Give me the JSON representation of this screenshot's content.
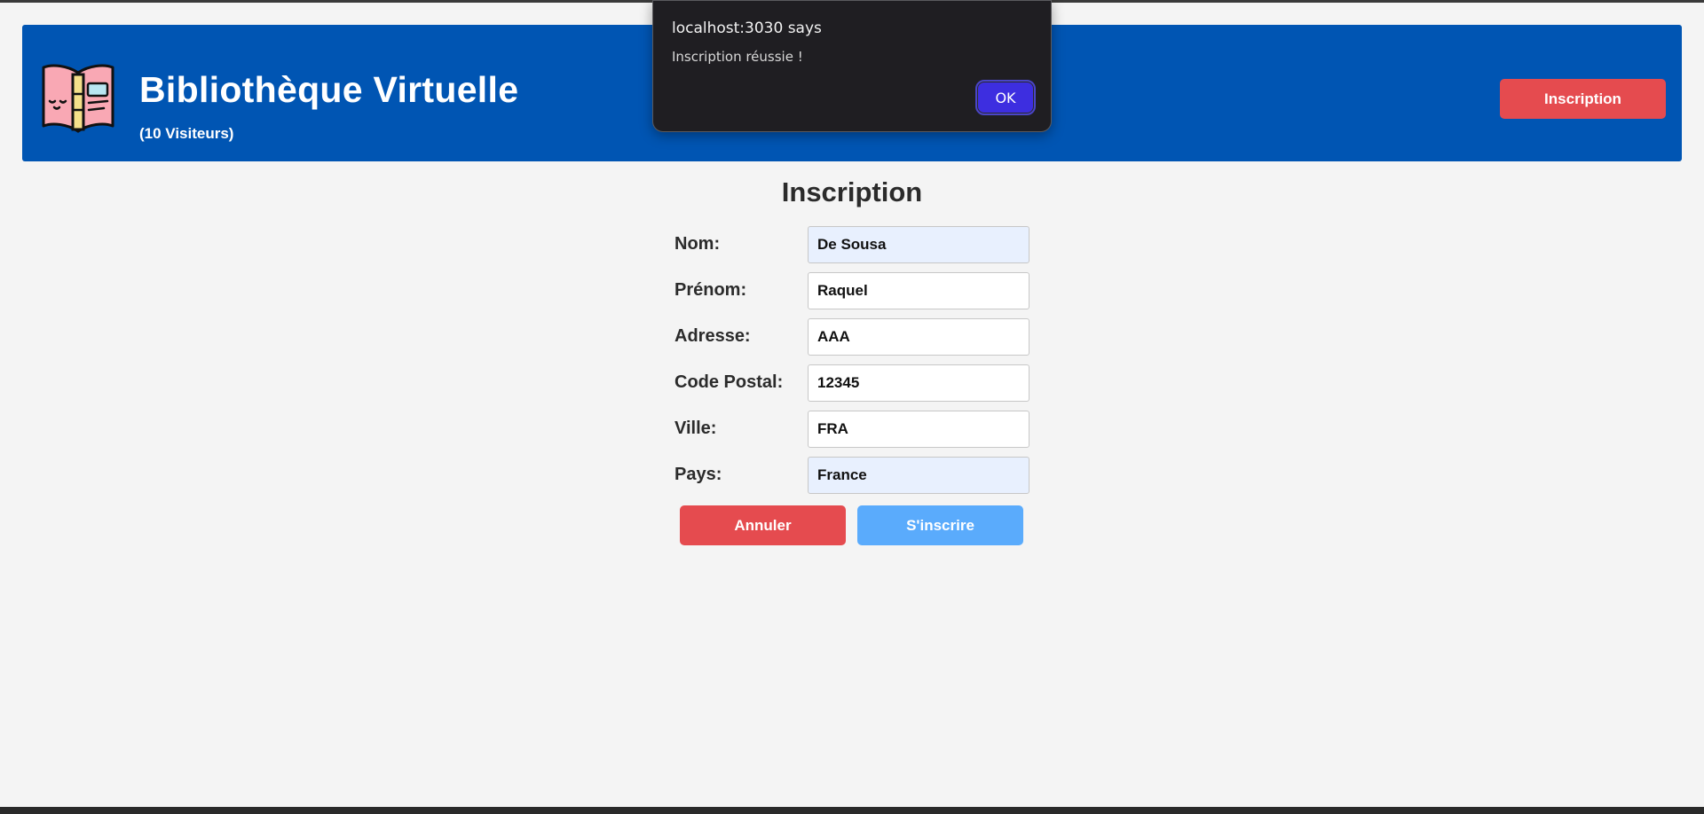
{
  "header": {
    "title": "Bibliothèque Virtuelle",
    "visitors": "(10 Visiteurs)",
    "signup_button": "Inscription",
    "logo_icon": "open-book-icon",
    "background": "#0055b3"
  },
  "form": {
    "title": "Inscription",
    "fields": [
      {
        "label": "Nom:",
        "value": "De Sousa",
        "autofilled": true
      },
      {
        "label": "Prénom:",
        "value": "Raquel",
        "autofilled": false
      },
      {
        "label": "Adresse:",
        "value": "AAA",
        "autofilled": false
      },
      {
        "label": "Code Postal:",
        "value": "12345",
        "autofilled": false
      },
      {
        "label": "Ville:",
        "value": "FRA",
        "autofilled": false
      },
      {
        "label": "Pays:",
        "value": "France",
        "autofilled": true
      }
    ],
    "cancel_label": "Annuler",
    "submit_label": "S'inscrire"
  },
  "dialog": {
    "title": "localhost:3030 says",
    "message": "Inscription réussie !",
    "ok_label": "OK"
  },
  "colors": {
    "accent_red": "#e54b4f",
    "accent_blue": "#5aabfc",
    "dialog_ok": "#3d2ee0"
  }
}
